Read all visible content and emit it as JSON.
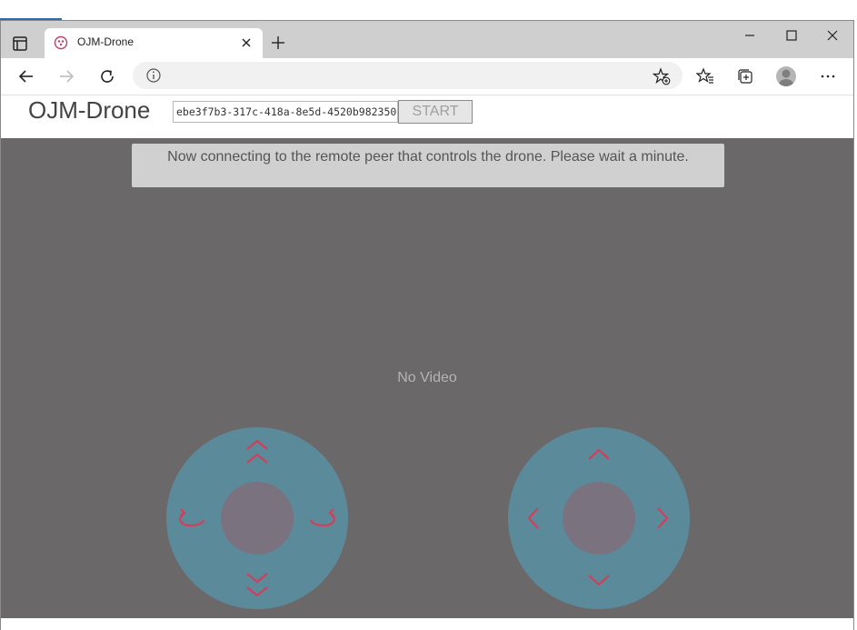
{
  "browser": {
    "tab_title": "OJM-Drone",
    "address_text": ""
  },
  "app": {
    "title": "OJM-Drone",
    "room_id": "ebe3f7b3-317c-418a-8e5d-4520b982350",
    "start_label": "START",
    "notice": "Now connecting to the remote peer that controls the drone. Please wait a minute.",
    "no_video": "No Video"
  },
  "colors": {
    "stage_bg": "#6b6869",
    "pad": "#5b8a9b",
    "hub": "#7b7280",
    "arrow": "#d0405a"
  },
  "icons": {
    "left_pad": [
      "double-chevron-up-icon",
      "double-chevron-down-icon",
      "rotate-left-icon",
      "rotate-right-icon"
    ],
    "right_pad": [
      "chevron-up-icon",
      "chevron-down-icon",
      "chevron-left-icon",
      "chevron-right-icon"
    ]
  }
}
